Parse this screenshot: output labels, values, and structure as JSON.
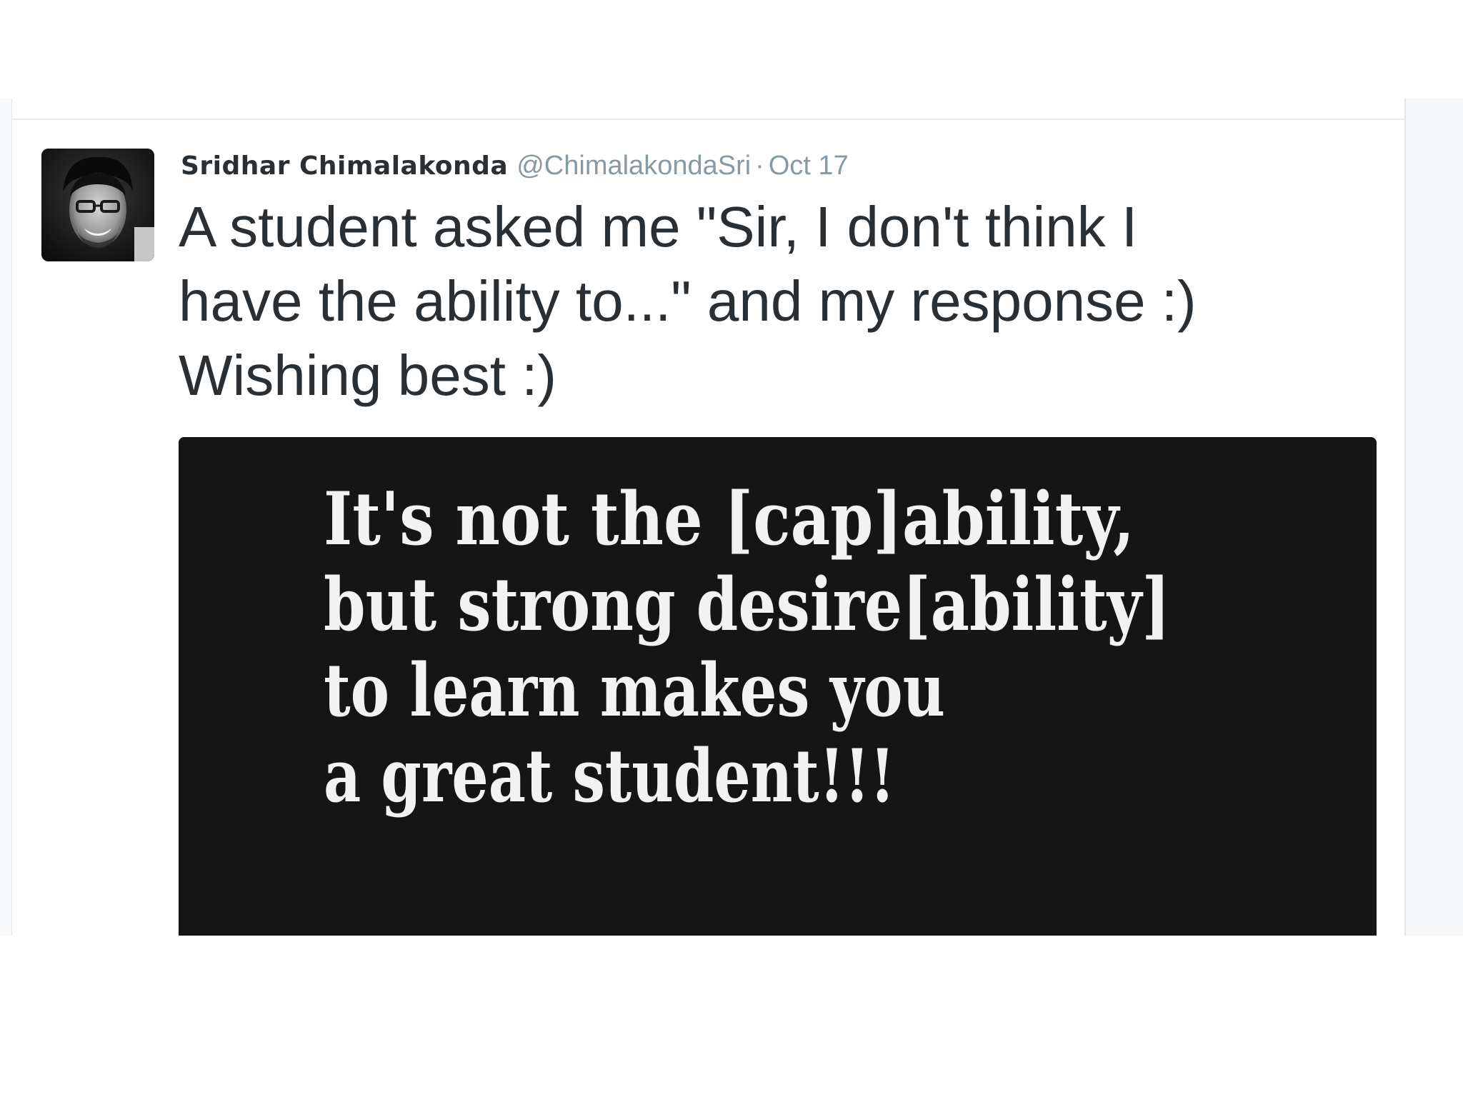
{
  "tweet": {
    "author": {
      "display_name": "Sridhar Chimalakonda",
      "handle": "@ChimalakondaSri"
    },
    "separator": "·",
    "timestamp": "Oct 17",
    "text_lines": [
      "A student asked me \"Sir, I don't think I",
      "have the ability to...\" and my response :)",
      "Wishing best :)"
    ],
    "media": {
      "lines": [
        "It's not the [cap]ability,",
        "but strong desire[ability]",
        "to learn makes you",
        "a great student!!!"
      ]
    }
  },
  "colors": {
    "name": "#292f33",
    "meta": "#8899a6",
    "text": "#292f33",
    "media_bg": "#151515",
    "media_text": "#f2f2f2"
  }
}
